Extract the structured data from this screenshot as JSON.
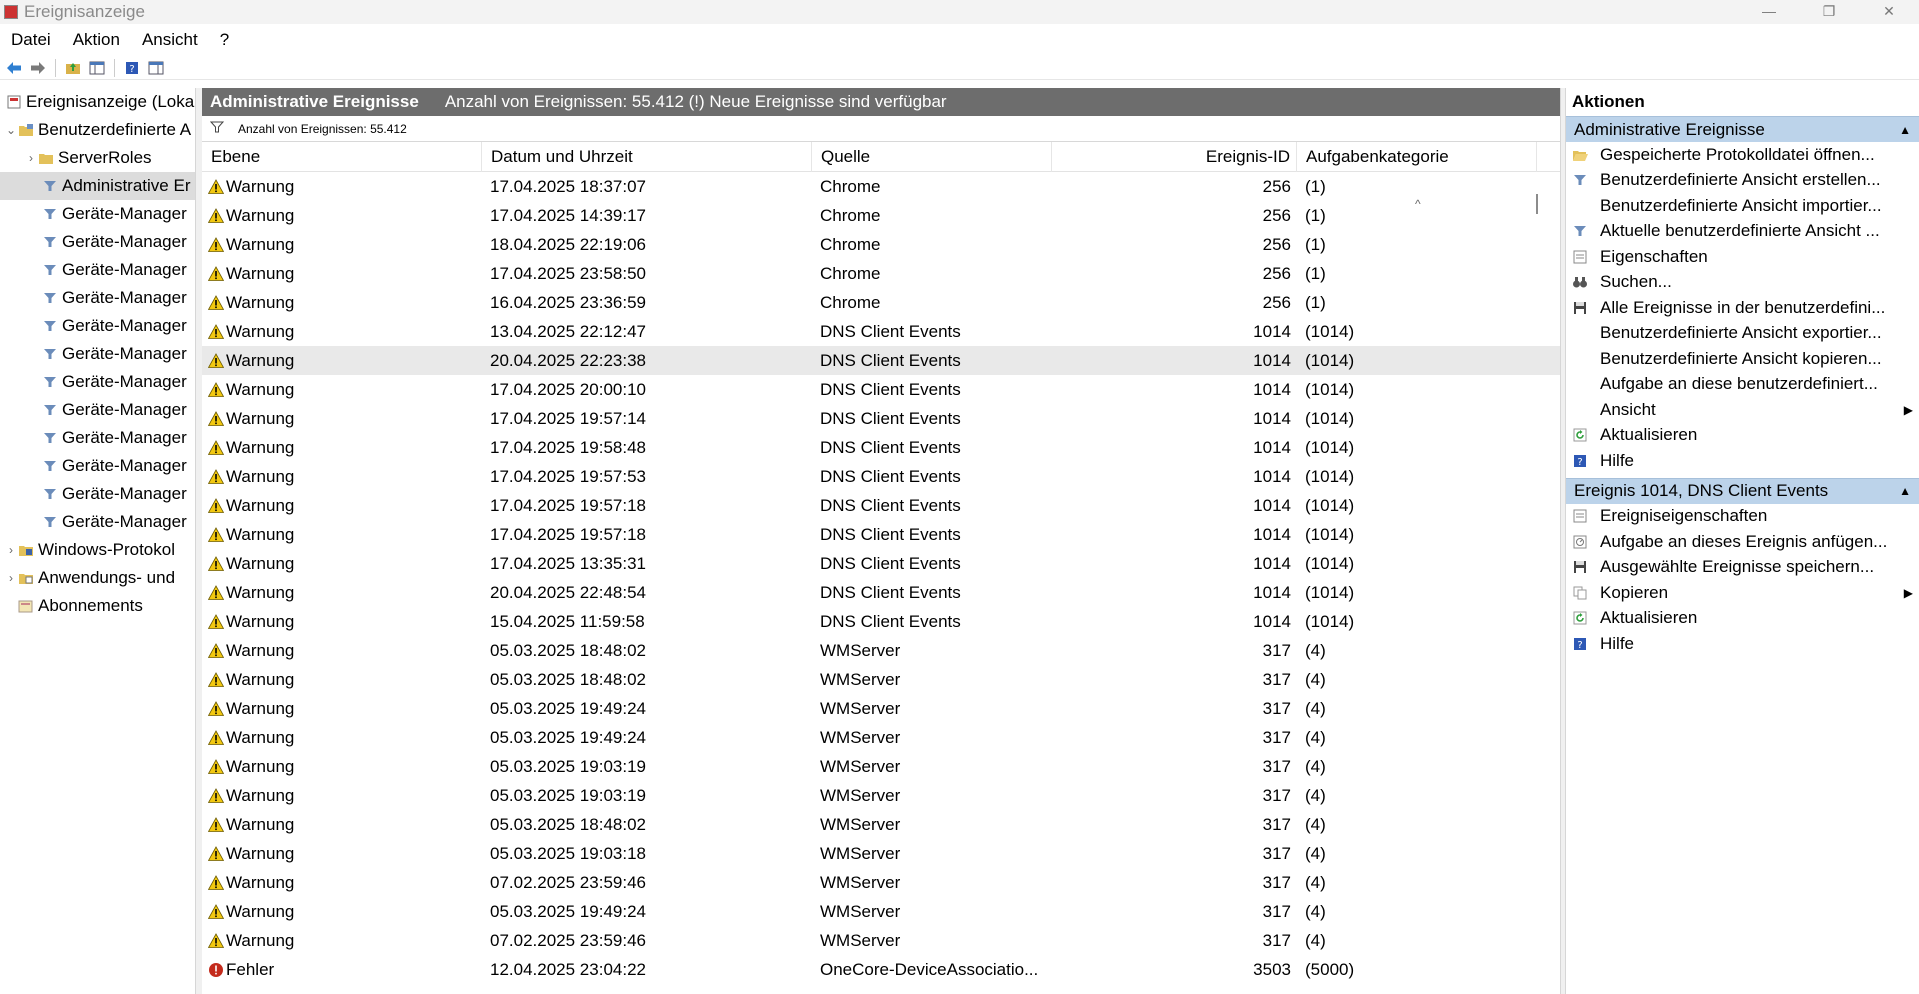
{
  "window": {
    "title": "Ereignisanzeige",
    "minimize": "—",
    "restore": "❐",
    "close": "✕"
  },
  "menu": [
    "Datei",
    "Aktion",
    "Ansicht",
    "?"
  ],
  "tree": {
    "root": "Ereignisanzeige (Loka",
    "custom_views": "Benutzerdefinierte A",
    "server_roles": "ServerRoles",
    "admin_events": "Administrative Er",
    "device_manager": "Geräte-Manager",
    "windows_logs": "Windows-Protokol",
    "app_logs": "Anwendungs- und",
    "subscriptions": "Abonnements"
  },
  "center": {
    "title": "Administrative Ereignisse",
    "subtitle": "Anzahl von Ereignissen: 55.412 (!) Neue Ereignisse sind verfügbar",
    "filter_text": "Anzahl von Ereignissen: 55.412",
    "columns": {
      "level": "Ebene",
      "date": "Datum und Uhrzeit",
      "source": "Quelle",
      "id": "Ereignis-ID",
      "category": "Aufgabenkategorie"
    },
    "sort_caret": "^",
    "rows": [
      {
        "level": "Warnung",
        "type": "warning",
        "date": "17.04.2025 18:37:07",
        "source": "Chrome",
        "id": "256",
        "category": "(1)"
      },
      {
        "level": "Warnung",
        "type": "warning",
        "date": "17.04.2025 14:39:17",
        "source": "Chrome",
        "id": "256",
        "category": "(1)"
      },
      {
        "level": "Warnung",
        "type": "warning",
        "date": "18.04.2025 22:19:06",
        "source": "Chrome",
        "id": "256",
        "category": "(1)"
      },
      {
        "level": "Warnung",
        "type": "warning",
        "date": "17.04.2025 23:58:50",
        "source": "Chrome",
        "id": "256",
        "category": "(1)"
      },
      {
        "level": "Warnung",
        "type": "warning",
        "date": "16.04.2025 23:36:59",
        "source": "Chrome",
        "id": "256",
        "category": "(1)"
      },
      {
        "level": "Warnung",
        "type": "warning",
        "date": "13.04.2025 22:12:47",
        "source": "DNS Client Events",
        "id": "1014",
        "category": "(1014)"
      },
      {
        "level": "Warnung",
        "type": "warning",
        "date": "20.04.2025 22:23:38",
        "source": "DNS Client Events",
        "id": "1014",
        "category": "(1014)",
        "selected": true
      },
      {
        "level": "Warnung",
        "type": "warning",
        "date": "17.04.2025 20:00:10",
        "source": "DNS Client Events",
        "id": "1014",
        "category": "(1014)"
      },
      {
        "level": "Warnung",
        "type": "warning",
        "date": "17.04.2025 19:57:14",
        "source": "DNS Client Events",
        "id": "1014",
        "category": "(1014)"
      },
      {
        "level": "Warnung",
        "type": "warning",
        "date": "17.04.2025 19:58:48",
        "source": "DNS Client Events",
        "id": "1014",
        "category": "(1014)"
      },
      {
        "level": "Warnung",
        "type": "warning",
        "date": "17.04.2025 19:57:53",
        "source": "DNS Client Events",
        "id": "1014",
        "category": "(1014)"
      },
      {
        "level": "Warnung",
        "type": "warning",
        "date": "17.04.2025 19:57:18",
        "source": "DNS Client Events",
        "id": "1014",
        "category": "(1014)"
      },
      {
        "level": "Warnung",
        "type": "warning",
        "date": "17.04.2025 19:57:18",
        "source": "DNS Client Events",
        "id": "1014",
        "category": "(1014)"
      },
      {
        "level": "Warnung",
        "type": "warning",
        "date": "17.04.2025 13:35:31",
        "source": "DNS Client Events",
        "id": "1014",
        "category": "(1014)"
      },
      {
        "level": "Warnung",
        "type": "warning",
        "date": "20.04.2025 22:48:54",
        "source": "DNS Client Events",
        "id": "1014",
        "category": "(1014)"
      },
      {
        "level": "Warnung",
        "type": "warning",
        "date": "15.04.2025 11:59:58",
        "source": "DNS Client Events",
        "id": "1014",
        "category": "(1014)"
      },
      {
        "level": "Warnung",
        "type": "warning",
        "date": "05.03.2025 18:48:02",
        "source": "WMServer",
        "id": "317",
        "category": "(4)"
      },
      {
        "level": "Warnung",
        "type": "warning",
        "date": "05.03.2025 18:48:02",
        "source": "WMServer",
        "id": "317",
        "category": "(4)"
      },
      {
        "level": "Warnung",
        "type": "warning",
        "date": "05.03.2025 19:49:24",
        "source": "WMServer",
        "id": "317",
        "category": "(4)"
      },
      {
        "level": "Warnung",
        "type": "warning",
        "date": "05.03.2025 19:49:24",
        "source": "WMServer",
        "id": "317",
        "category": "(4)"
      },
      {
        "level": "Warnung",
        "type": "warning",
        "date": "05.03.2025 19:03:19",
        "source": "WMServer",
        "id": "317",
        "category": "(4)"
      },
      {
        "level": "Warnung",
        "type": "warning",
        "date": "05.03.2025 19:03:19",
        "source": "WMServer",
        "id": "317",
        "category": "(4)"
      },
      {
        "level": "Warnung",
        "type": "warning",
        "date": "05.03.2025 18:48:02",
        "source": "WMServer",
        "id": "317",
        "category": "(4)"
      },
      {
        "level": "Warnung",
        "type": "warning",
        "date": "05.03.2025 19:03:18",
        "source": "WMServer",
        "id": "317",
        "category": "(4)"
      },
      {
        "level": "Warnung",
        "type": "warning",
        "date": "07.02.2025 23:59:46",
        "source": "WMServer",
        "id": "317",
        "category": "(4)"
      },
      {
        "level": "Warnung",
        "type": "warning",
        "date": "05.03.2025 19:49:24",
        "source": "WMServer",
        "id": "317",
        "category": "(4)"
      },
      {
        "level": "Warnung",
        "type": "warning",
        "date": "07.02.2025 23:59:46",
        "source": "WMServer",
        "id": "317",
        "category": "(4)"
      },
      {
        "level": "Fehler",
        "type": "error",
        "date": "12.04.2025 23:04:22",
        "source": "OneCore-DeviceAssociatio...",
        "id": "3503",
        "category": "(5000)"
      }
    ]
  },
  "actions": {
    "title": "Aktionen",
    "section1": {
      "title": "Administrative Ereignisse",
      "items": [
        {
          "label": "Gespeicherte Protokolldatei öffnen...",
          "icon": "folder-open-icon"
        },
        {
          "label": "Benutzerdefinierte Ansicht erstellen...",
          "icon": "filter-icon"
        },
        {
          "label": "Benutzerdefinierte Ansicht importier...",
          "icon": ""
        },
        {
          "label": "Aktuelle benutzerdefinierte Ansicht ...",
          "icon": "filter-icon"
        },
        {
          "label": "Eigenschaften",
          "icon": "properties-icon"
        },
        {
          "label": "Suchen...",
          "icon": "binoculars-icon"
        },
        {
          "label": "Alle Ereignisse in der benutzerdefini...",
          "icon": "save-icon"
        },
        {
          "label": "Benutzerdefinierte Ansicht exportier...",
          "icon": ""
        },
        {
          "label": "Benutzerdefinierte Ansicht kopieren...",
          "icon": ""
        },
        {
          "label": "Aufgabe an diese benutzerdefiniert...",
          "icon": ""
        },
        {
          "label": "Ansicht",
          "icon": "",
          "submenu": true
        },
        {
          "label": "Aktualisieren",
          "icon": "refresh-icon"
        },
        {
          "label": "Hilfe",
          "icon": "help-icon"
        }
      ]
    },
    "section2": {
      "title": "Ereignis 1014, DNS Client Events",
      "items": [
        {
          "label": "Ereigniseigenschaften",
          "icon": "properties-icon"
        },
        {
          "label": "Aufgabe an dieses Ereignis anfügen...",
          "icon": "task-icon"
        },
        {
          "label": "Ausgewählte Ereignisse speichern...",
          "icon": "save-icon"
        },
        {
          "label": "Kopieren",
          "icon": "copy-icon",
          "submenu": true
        },
        {
          "label": "Aktualisieren",
          "icon": "refresh-icon"
        },
        {
          "label": "Hilfe",
          "icon": "help-icon"
        }
      ]
    }
  },
  "colors": {
    "section_bg": "#bcd3ea",
    "header_bg": "#6d6d6d",
    "warning": "#f2c811",
    "error": "#c42b1c"
  }
}
